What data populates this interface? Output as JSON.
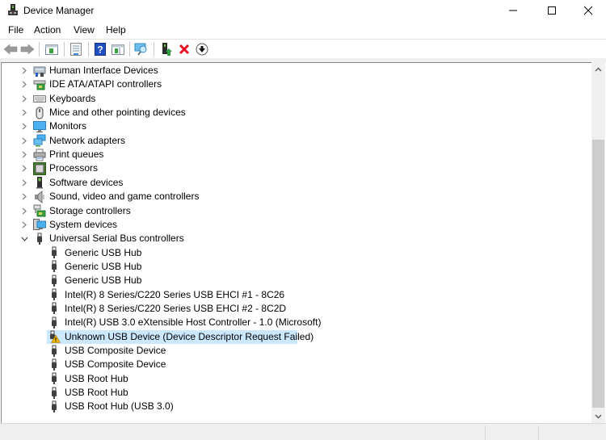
{
  "window": {
    "title": "Device Manager",
    "controls": {
      "minimize": "minimize-icon",
      "maximize": "maximize-icon",
      "close": "close-icon"
    }
  },
  "menu": {
    "items": [
      "File",
      "Action",
      "View",
      "Help"
    ]
  },
  "toolbar": {
    "buttons": [
      {
        "name": "back",
        "icon": "arrow-left-icon"
      },
      {
        "name": "forward",
        "icon": "arrow-right-icon"
      },
      {
        "name": "show-hide-console-tree",
        "icon": "console-tree-icon"
      },
      {
        "name": "properties",
        "icon": "properties-icon"
      },
      {
        "name": "help",
        "icon": "help-icon"
      },
      {
        "name": "show-action-pane",
        "icon": "action-pane-icon"
      },
      {
        "name": "scan-hardware-changes",
        "icon": "scan-monitor-icon"
      },
      {
        "name": "update-driver",
        "icon": "update-driver-icon"
      },
      {
        "name": "uninstall-device",
        "icon": "red-x-icon"
      },
      {
        "name": "disable-device",
        "icon": "down-arrow-circle-icon"
      }
    ]
  },
  "tree": {
    "categories": [
      {
        "label": "Human Interface Devices",
        "icon": "hid-icon",
        "expanded": false
      },
      {
        "label": "IDE ATA/ATAPI controllers",
        "icon": "ide-controller-icon",
        "expanded": false
      },
      {
        "label": "Keyboards",
        "icon": "keyboard-icon",
        "expanded": false
      },
      {
        "label": "Mice and other pointing devices",
        "icon": "mouse-icon",
        "expanded": false
      },
      {
        "label": "Monitors",
        "icon": "monitor-icon",
        "expanded": false
      },
      {
        "label": "Network adapters",
        "icon": "network-icon",
        "expanded": false
      },
      {
        "label": "Print queues",
        "icon": "printer-icon",
        "expanded": false
      },
      {
        "label": "Processors",
        "icon": "processor-icon",
        "expanded": false
      },
      {
        "label": "Software devices",
        "icon": "software-device-icon",
        "expanded": false
      },
      {
        "label": "Sound, video and game controllers",
        "icon": "speaker-icon",
        "expanded": false
      },
      {
        "label": "Storage controllers",
        "icon": "storage-controller-icon",
        "expanded": false
      },
      {
        "label": "System devices",
        "icon": "system-devices-icon",
        "expanded": false
      },
      {
        "label": "Universal Serial Bus controllers",
        "icon": "usb-icon",
        "expanded": true
      }
    ],
    "usb_children": [
      {
        "label": "Generic USB Hub",
        "warning": false,
        "selected": false
      },
      {
        "label": "Generic USB Hub",
        "warning": false,
        "selected": false
      },
      {
        "label": "Generic USB Hub",
        "warning": false,
        "selected": false
      },
      {
        "label": "Intel(R) 8 Series/C220 Series USB EHCI #1 - 8C26",
        "warning": false,
        "selected": false
      },
      {
        "label": "Intel(R) 8 Series/C220 Series USB EHCI #2 - 8C2D",
        "warning": false,
        "selected": false
      },
      {
        "label": "Intel(R) USB 3.0 eXtensible Host Controller - 1.0 (Microsoft)",
        "warning": false,
        "selected": false
      },
      {
        "label": "Unknown USB Device (Device Descriptor Request Failed)",
        "warning": true,
        "selected": true
      },
      {
        "label": "USB Composite Device",
        "warning": false,
        "selected": false
      },
      {
        "label": "USB Composite Device",
        "warning": false,
        "selected": false
      },
      {
        "label": "USB Root Hub",
        "warning": false,
        "selected": false
      },
      {
        "label": "USB Root Hub",
        "warning": false,
        "selected": false
      },
      {
        "label": "USB Root Hub (USB 3.0)",
        "warning": false,
        "selected": false
      }
    ]
  },
  "colors": {
    "selection": "#cce8ff",
    "warning": "#f0b400",
    "delete": "#e81123",
    "accent_blue": "#1e90ff"
  }
}
